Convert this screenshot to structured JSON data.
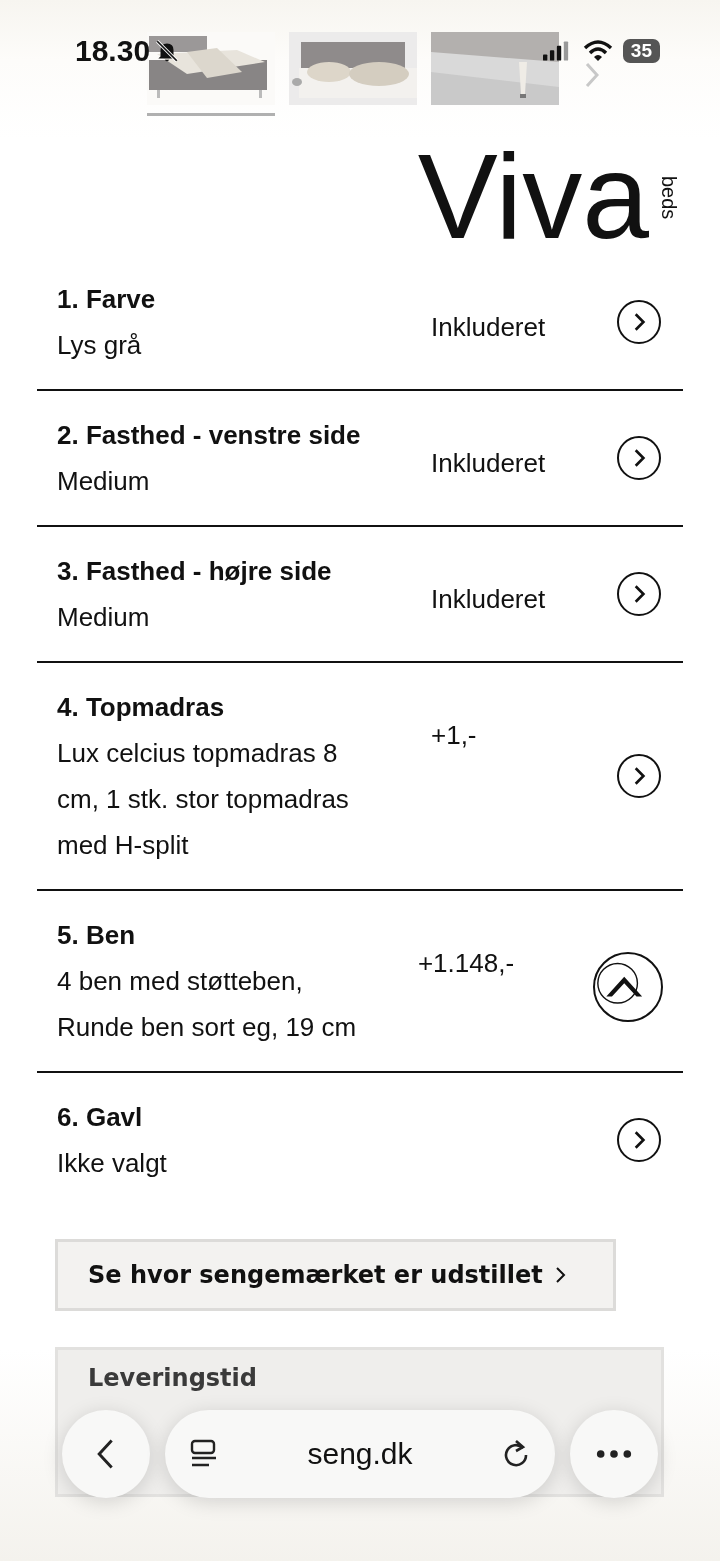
{
  "status_bar": {
    "time": "18.30",
    "battery": "35"
  },
  "gallery": {
    "thumbnails": [
      {
        "kind": "picture",
        "selected": true
      },
      {
        "kind": "picture",
        "selected": false
      },
      {
        "kind": "picture",
        "selected": false
      }
    ]
  },
  "logo": {
    "name": "Viva",
    "sub": "beds"
  },
  "options": [
    {
      "title": "1. Farve",
      "subtitle": "Lys grå",
      "price": "Inkluderet",
      "expanded": false
    },
    {
      "title": "2. Fasthed - venstre side",
      "subtitle": "Medium",
      "price": "Inkluderet",
      "expanded": false
    },
    {
      "title": "3. Fasthed - højre side",
      "subtitle": "Medium",
      "price": "Inkluderet",
      "expanded": false
    },
    {
      "title": "4. Topmadras",
      "subtitle": "Lux celcius topmadras 8 cm, 1 stk. stor topmadras med H-split",
      "price": "+1,-",
      "expanded": false
    },
    {
      "title": "5. Ben",
      "subtitle": "4 ben med støtteben, Runde ben sort eg, 19 cm",
      "price": "+1.148,-",
      "expanded": true
    },
    {
      "title": "6. Gavl",
      "subtitle": "Ikke valgt",
      "expanded": false
    }
  ],
  "showroom_button": {
    "label": "Se hvor sengemærket er udstillet"
  },
  "delivery": {
    "title": "Leveringstid"
  },
  "browser": {
    "url": "seng.dk"
  }
}
